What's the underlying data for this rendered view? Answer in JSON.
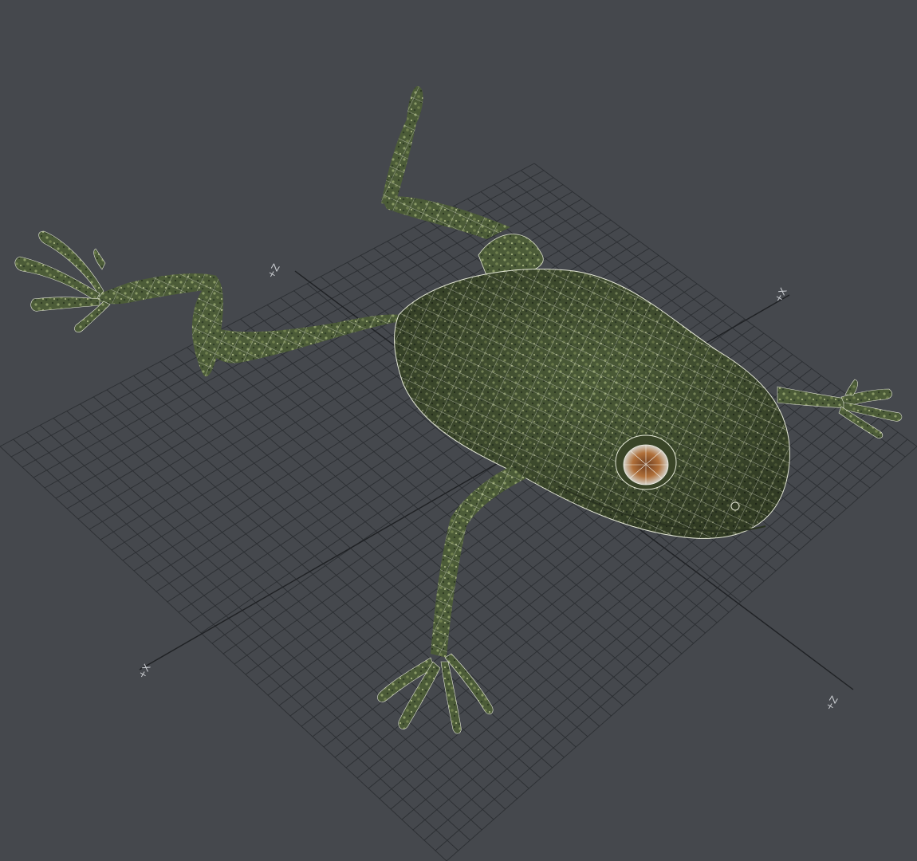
{
  "viewport": {
    "background": "#45484d",
    "grid_color": "#2c2f33",
    "axis_color": "#1f2124",
    "wire_color": "#f2f2ea",
    "skin_base": "#4a5a36",
    "skin_light": "#7c8c5a",
    "skin_dark": "#2d3a22",
    "eye_iris": "#b0703a"
  },
  "axes": {
    "x_pos": "+X",
    "x_neg": "+X",
    "z_pos": "+Z",
    "z_neg": "+Z"
  },
  "model": {
    "name_icon": "frog-wireframe-mesh"
  }
}
